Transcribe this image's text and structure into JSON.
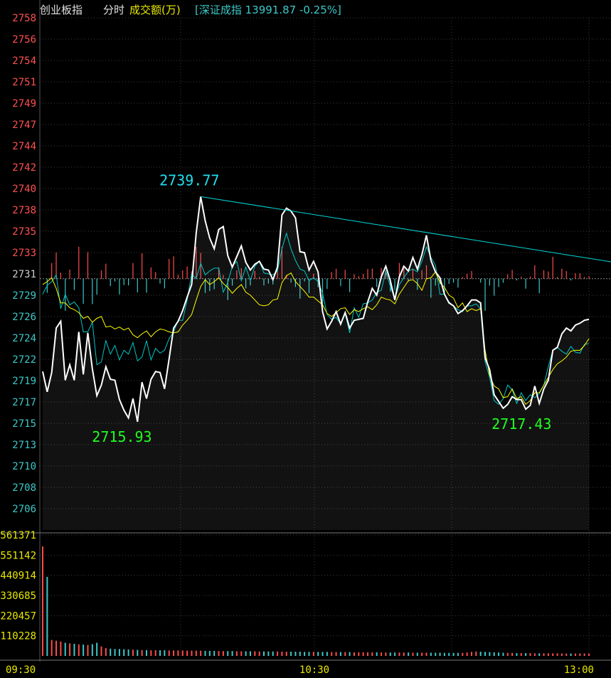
{
  "header": {
    "index_name": "创业板指",
    "mode": "分时",
    "volume_label": "成交额(万)",
    "compare": "[深证成指 13991.87 -0.25%]"
  },
  "colors": {
    "background": "#000000",
    "grid": "#2a2a2a",
    "price_line": "#ffffff",
    "avg_line": "#ffff00",
    "compare_line": "#00c8c8",
    "trend_line": "#00d8d8",
    "up": "#ff4b4b",
    "down": "#3cc8c8",
    "max_label": "#20e0f0",
    "min_label": "#20ff20",
    "axis_up": "#ff5050",
    "axis_down": "#3cc8c8",
    "axis_vol": "#e8e800"
  },
  "chart_data": {
    "type": "line",
    "pre_close": 2731,
    "ylim": [
      2705,
      2758
    ],
    "y_ticks": [
      "2758",
      "2756",
      "2754",
      "2751",
      "2749",
      "2747",
      "2744",
      "2742",
      "2740",
      "2738",
      "2735",
      "2733",
      "2731",
      "2729",
      "2726",
      "2724",
      "2722",
      "2719",
      "2717",
      "2715",
      "2713",
      "2710",
      "2708",
      "2706"
    ],
    "x_ticks": [
      "09:30",
      "10:30",
      "13:00"
    ],
    "annotations": {
      "high": "2739.77",
      "low": "2715.93",
      "low2": "2717.43"
    },
    "volume_ticks": [
      "561371",
      "551142",
      "440914",
      "330685",
      "220457",
      "110228"
    ],
    "volume_max": 561371,
    "price": [
      2721.4,
      2719.3,
      2721.3,
      2725.9,
      2726.6,
      2720.5,
      2722.1,
      2720.5,
      2725.5,
      2721.1,
      2725.4,
      2721.7,
      2718.9,
      2720.0,
      2721.9,
      2720.6,
      2720.5,
      2718.5,
      2717.4,
      2716.6,
      2718.6,
      2716.2,
      2720.3,
      2718.6,
      2720.6,
      2721.4,
      2721.3,
      2719.6,
      2722.7,
      2725.9,
      2726.6,
      2727.7,
      2729.1,
      2730.4,
      2735.7,
      2739.5,
      2737.0,
      2735.2,
      2734.1,
      2736.1,
      2736.4,
      2733.4,
      2732.2,
      2733.3,
      2734.4,
      2732.7,
      2731.9,
      2732.5,
      2732.8,
      2732.0,
      2731.9,
      2730.9,
      2732.2,
      2737.6,
      2738.3,
      2738.0,
      2737.3,
      2733.8,
      2733.7,
      2731.9,
      2732.8,
      2731.7,
      2727.6,
      2725.8,
      2726.6,
      2727.6,
      2726.3,
      2727.5,
      2725.9,
      2726.7,
      2726.8,
      2726.9,
      2728.6,
      2730.0,
      2729.3,
      2731.2,
      2732.3,
      2730.8,
      2728.8,
      2731.2,
      2732.3,
      2731.8,
      2733.2,
      2732.0,
      2733.5,
      2735.5,
      2732.9,
      2731.7,
      2731.1,
      2729.4,
      2728.5,
      2728.2,
      2727.4,
      2727.7,
      2728.2,
      2728.8,
      2728.8,
      2728.5,
      2722.8,
      2721.6,
      2719.0,
      2718.3,
      2717.6,
      2718.0,
      2718.8,
      2718.5,
      2718.5,
      2717.5,
      2717.9,
      2719.9,
      2718.1,
      2719.6,
      2720.5,
      2723.6,
      2723.9,
      2725.3,
      2725.9,
      2725.6,
      2726.2,
      2726.4,
      2726.7,
      2726.8
    ],
    "average": [
      2730.4,
      2730.7,
      2731.1,
      2730.0,
      2728.5,
      2728.5,
      2728.0,
      2727.8,
      2727.5,
      2726.9,
      2727.1,
      2726.5,
      2726.9,
      2727.1,
      2726.0,
      2726.1,
      2725.8,
      2726.0,
      2725.7,
      2725.9,
      2725.2,
      2724.9,
      2725.3,
      2725.6,
      2725.0,
      2725.5,
      2725.8,
      2725.7,
      2725.5,
      2725.4,
      2725.5,
      2726.2,
      2726.7,
      2727.3,
      2728.8,
      2730.2,
      2730.9,
      2730.4,
      2730.7,
      2731.1,
      2730.5,
      2730.1,
      2729.5,
      2730.0,
      2730.4,
      2729.6,
      2729.3,
      2728.8,
      2728.3,
      2728.2,
      2728.3,
      2728.8,
      2728.9,
      2730.6,
      2731.3,
      2731.6,
      2730.7,
      2730.2,
      2729.7,
      2729.1,
      2729.1,
      2728.7,
      2728.3,
      2727.4,
      2727.1,
      2727.5,
      2727.9,
      2728.0,
      2727.3,
      2727.8,
      2727.6,
      2727.9,
      2728.1,
      2727.8,
      2728.3,
      2729.1,
      2728.9,
      2728.8,
      2728.4,
      2729.4,
      2730.1,
      2730.8,
      2730.9,
      2730.5,
      2729.8,
      2731.0,
      2731.1,
      2731.7,
      2730.6,
      2730.1,
      2729.3,
      2729.0,
      2728.0,
      2728.5,
      2727.6,
      2727.9,
      2727.7,
      2727.9,
      2723.6,
      2721.0,
      2719.9,
      2719.6,
      2718.7,
      2718.8,
      2719.6,
      2718.6,
      2718.8,
      2718.0,
      2718.4,
      2719.2,
      2719.2,
      2720.0,
      2720.8,
      2721.6,
      2722.2,
      2722.5,
      2722.9,
      2723.5,
      2723.6,
      2723.6,
      2724.1,
      2724.8
    ],
    "compare": [
      2729.4,
      2730.3,
      2730.7,
      2731.4,
      2727.9,
      2729.4,
      2728.3,
      2728.6,
      2728.0,
      2725.5,
      2725.5,
      2726.5,
      2722.1,
      2722.4,
      2724.6,
      2723.2,
      2724.1,
      2722.6,
      2723.6,
      2723.2,
      2724.4,
      2722.5,
      2722.9,
      2724.6,
      2722.6,
      2723.8,
      2723.3,
      2723.6,
      2724.8,
      2725.5,
      2726.7,
      2726.7,
      2728.8,
      2731.5,
      2731.0,
      2732.6,
      2731.4,
      2731.8,
      2732.1,
      2732.1,
      2729.6,
      2730.6,
      2732.3,
      2732.8,
      2730.8,
      2732.2,
      2730.8,
      2732.3,
      2732.8,
      2731.6,
      2731.5,
      2731.4,
      2731.8,
      2734.1,
      2735.7,
      2734.1,
      2732.9,
      2732.0,
      2731.8,
      2730.8,
      2731.1,
      2730.7,
      2729.5,
      2727.3,
      2726.8,
      2727.0,
      2726.3,
      2727.4,
      2725.4,
      2728.0,
      2727.0,
      2728.4,
      2728.5,
      2728.8,
      2729.6,
      2729.8,
      2731.8,
      2730.2,
      2728.9,
      2730.4,
      2731.1,
      2731.8,
      2732.0,
      2731.7,
      2732.8,
      2734.3,
      2733.2,
      2732.4,
      2729.4,
      2729.4,
      2728.6,
      2728.2,
      2727.8,
      2727.6,
      2728.2,
      2728.2,
      2728.4,
      2727.9,
      2722.4,
      2720.8,
      2718.4,
      2718.0,
      2718.6,
      2720.0,
      2719.5,
      2718.1,
      2719.2,
      2718.4,
      2719.0,
      2718.7,
      2719.1,
      2720.0,
      2721.9,
      2723.6,
      2723.9,
      2723.5,
      2723.2,
      2724.0,
      2723.4,
      2723.3,
      2724.2,
      2724.3
    ],
    "volume": [
      540000,
      390000,
      79000,
      75000,
      71000,
      65000,
      62000,
      60000,
      57000,
      56000,
      54000,
      58000,
      65000,
      47000,
      39000,
      36000,
      34000,
      34000,
      33000,
      32000,
      31000,
      30000,
      29000,
      29000,
      28000,
      28000,
      28000,
      28000,
      27000,
      27000,
      27000,
      27000,
      26000,
      26000,
      26000,
      26000,
      25000,
      25000,
      25000,
      24000,
      24000,
      24000,
      24000,
      23000,
      23000,
      23000,
      23000,
      23000,
      22000,
      22000,
      22000,
      22000,
      22000,
      21000,
      21000,
      21000,
      21000,
      21000,
      20000,
      20000,
      20000,
      20000,
      20000,
      20000,
      19000,
      19000,
      19000,
      19000,
      19000,
      18000,
      18000,
      18000,
      18000,
      18000,
      18000,
      17000,
      17000,
      17000,
      17000,
      17000,
      17000,
      17000,
      16000,
      16000,
      16000,
      16000,
      16000,
      16000,
      16000,
      15000,
      15000,
      15000,
      15000,
      15000,
      17000,
      20000,
      22000,
      21000,
      20000,
      19000,
      18000,
      17000,
      16000,
      15000,
      15000,
      14000,
      14000,
      14000,
      14000,
      13000,
      13000,
      13000,
      13000,
      13000,
      13000,
      12000,
      12000,
      12000,
      12000,
      12000,
      12000,
      12000
    ]
  }
}
